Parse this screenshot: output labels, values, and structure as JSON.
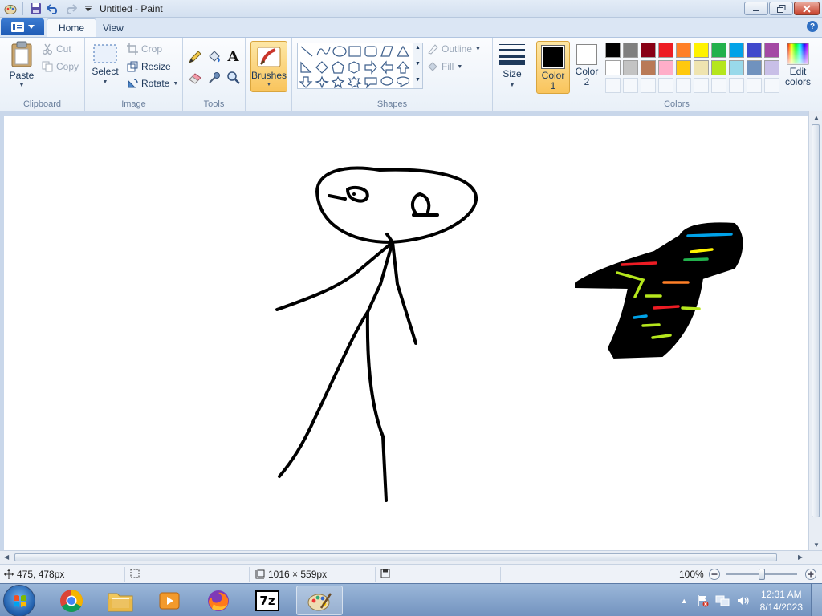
{
  "window": {
    "title": "Untitled - Paint"
  },
  "tabs": {
    "home": "Home",
    "view": "View"
  },
  "help": "?",
  "ribbon": {
    "clipboard": {
      "label": "Clipboard",
      "paste": "Paste",
      "cut": "Cut",
      "copy": "Copy"
    },
    "image": {
      "label": "Image",
      "select": "Select",
      "crop": "Crop",
      "resize": "Resize",
      "rotate": "Rotate"
    },
    "tools": {
      "label": "Tools",
      "text_glyph": "A"
    },
    "brushes": {
      "label": "Brushes"
    },
    "shapes": {
      "label": "Shapes",
      "outline": "Outline",
      "fill": "Fill"
    },
    "size": {
      "label": "Size"
    },
    "colors": {
      "label": "Colors",
      "color1": "Color 1",
      "color1_line1": "Color",
      "color1_line2": "1",
      "color2_line1": "Color",
      "color2_line2": "2",
      "color1_value": "#000000",
      "color2_value": "#ffffff",
      "edit": "Edit colors",
      "edit_line1": "Edit",
      "edit_line2": "colors",
      "palette_row1": [
        "#000000",
        "#7f7f7f",
        "#880015",
        "#ed1c24",
        "#ff7f27",
        "#fff200",
        "#22b14c",
        "#00a2e8",
        "#3f48cc",
        "#a349a4"
      ],
      "palette_row2": [
        "#ffffff",
        "#c3c3c3",
        "#b97a57",
        "#ffaec9",
        "#ffc90e",
        "#efe4b0",
        "#b5e61d",
        "#99d9ea",
        "#7092be",
        "#c8bfe7"
      ]
    }
  },
  "status": {
    "cursor": "475, 478px",
    "canvas_size": "1016 × 559px",
    "zoom": "100%"
  },
  "taskbar": {
    "apps": [
      "chrome",
      "file-explorer",
      "media-player",
      "firefox",
      "7-zip",
      "paint"
    ],
    "seven_zip_label": "7z",
    "time": "12:31 AM",
    "date": "8/14/2023"
  }
}
